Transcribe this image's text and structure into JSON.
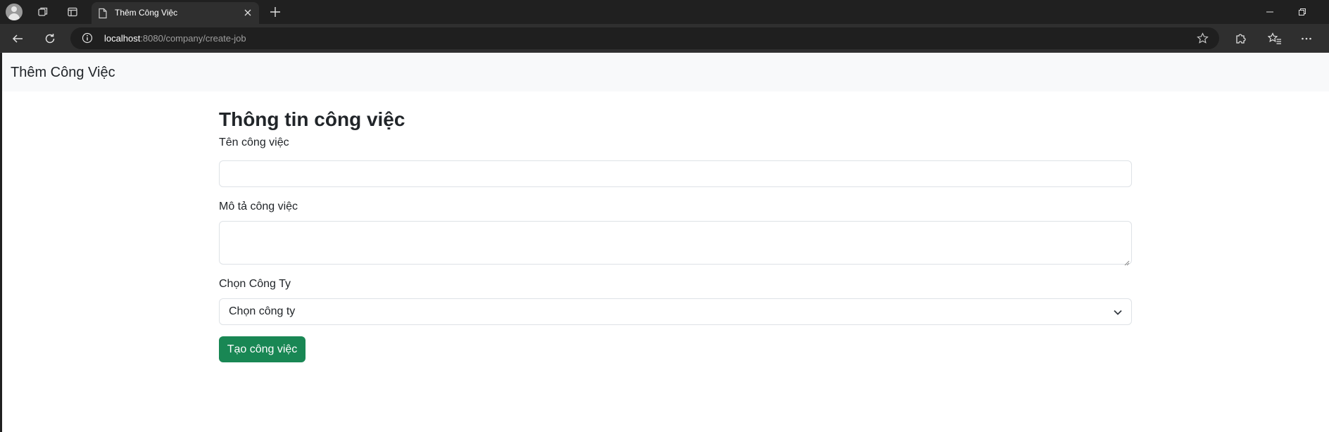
{
  "browser": {
    "tab_title": "Thêm Công Việc",
    "url_host": "localhost",
    "url_rest": ":8080/company/create-job"
  },
  "navbar": {
    "brand": "Thêm Công Việc"
  },
  "form": {
    "heading": "Thông tin công việc",
    "job_name_label": "Tên công việc",
    "job_name_value": "",
    "job_desc_label": "Mô tả công việc",
    "job_desc_value": "",
    "company_label": "Chọn Công Ty",
    "company_selected": "Chọn công ty",
    "submit_label": "Tạo công việc"
  },
  "colors": {
    "submit_button": "#198754",
    "navbar_bg": "#f8f9fa",
    "chrome_bg": "#202020"
  },
  "icons": [
    "profile-avatar-icon",
    "workspaces-icon",
    "tab-actions-icon",
    "page-icon",
    "close-icon",
    "new-tab-icon",
    "minimize-icon",
    "restore-icon",
    "back-icon",
    "refresh-icon",
    "site-info-icon",
    "favorite-star-icon",
    "extensions-icon",
    "favorites-icon",
    "more-icon",
    "chevron-down-icon"
  ]
}
